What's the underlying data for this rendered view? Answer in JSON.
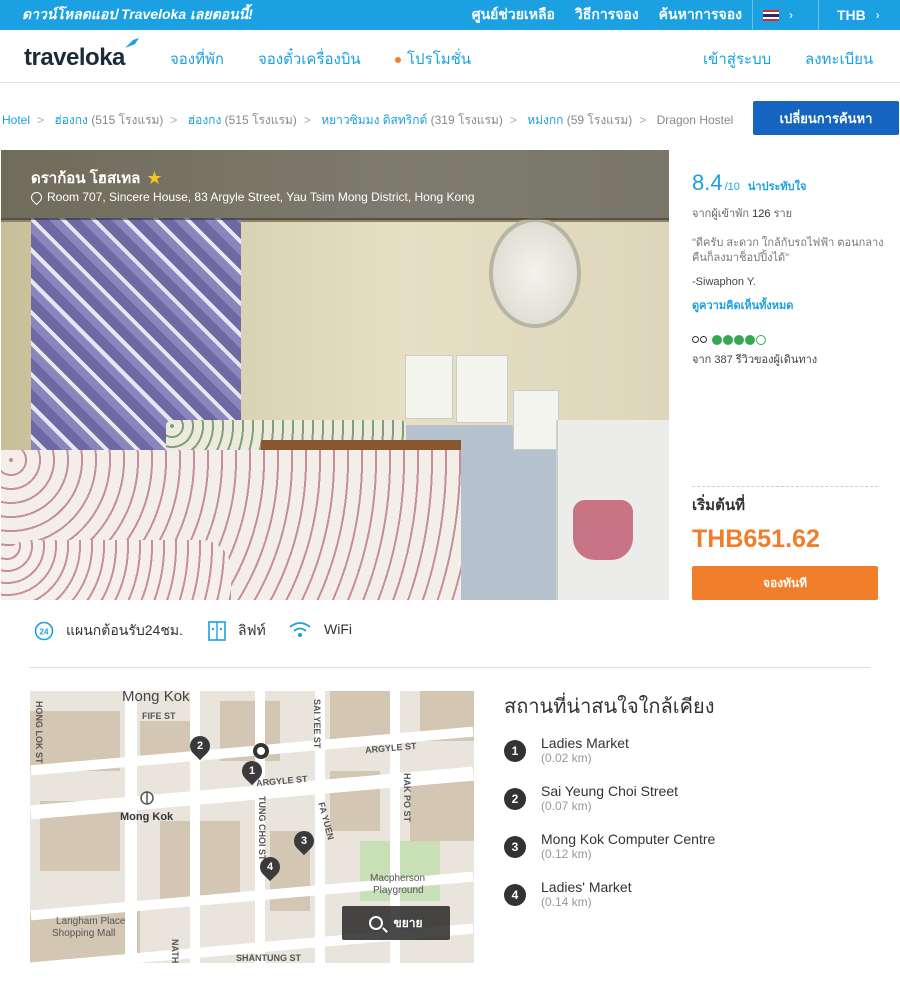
{
  "topbar": {
    "promo": "ดาวน์โหลดแอป Traveloka เลยตอนนี้!",
    "help": "ศูนย์ช่วยเหลือ",
    "howto": "วิธีการจอง",
    "find_booking": "ค้นหาการจอง",
    "currency": "THB"
  },
  "nav": {
    "logo": "traveloka",
    "hotels": "จองที่พัก",
    "flights": "จองตั๋วเครื่องบิน",
    "promos": "โปรโมชั่น",
    "login": "เข้าสู่ระบบ",
    "register": "ลงทะเบียน"
  },
  "breadcrumb": {
    "items": [
      {
        "label": "Hotel",
        "count": ""
      },
      {
        "label": "ฮ่องกง",
        "count": "(515 โรงแรม)"
      },
      {
        "label": "ฮ่องกง",
        "count": "(515 โรงแรม)"
      },
      {
        "label": "หยาวซิมมง ดิสทริกต์",
        "count": "(319 โรงแรม)"
      },
      {
        "label": "หม่งกก",
        "count": "(59 โรงแรม)"
      }
    ],
    "current": "Dragon Hostel",
    "change_search": "เปลี่ยนการค้นหา"
  },
  "hotel": {
    "name": "ดราก้อน โฮสเทล",
    "address": "Room 707, Sincere House, 83 Argyle Street, Yau Tsim Mong District, Hong Kong",
    "star_rating": 1
  },
  "review": {
    "score": "8.4",
    "out_of": "/10",
    "verdict": "น่าประทับใจ",
    "guest_prefix": "จากผู้เข้าพัก",
    "guest_count": "126",
    "guest_suffix": "ราย",
    "quote": "\"ดีครับ สะดวก ใกล้กับรถไฟฟ้า ตอนกลางคืนก็ลงมาช็อปปิ้งได้\"",
    "reviewer": "-Siwaphon Y.",
    "see_all": "ดูความคิดเห็นทั้งหมด",
    "tripadvisor_bubbles": 4,
    "tripadvisor_text": "จาก 387 รีวิวของผู้เดินทาง"
  },
  "pricing": {
    "from": "เริ่มต้นที่",
    "price": "THB651.62",
    "book": "จองทันที"
  },
  "amenities": [
    {
      "icon": "24h-icon",
      "label": "แผนกต้อนรับ24ชม."
    },
    {
      "icon": "elevator-icon",
      "label": "ลิฟท์"
    },
    {
      "icon": "wifi-icon",
      "label": "WiFi"
    }
  ],
  "map": {
    "zoom": "ขยาย",
    "labels": {
      "mongkok_top": "Mong Kok",
      "mongkok_station": "Mong Kok",
      "fife": "FIFE ST",
      "sai_yee": "SAI YEE ST",
      "argyle_right": "ARGYLE ST",
      "argyle_left": "ARGYLE ST",
      "hong_lok": "HONG LOK ST",
      "tung_choi": "TUNG CHOI ST",
      "fa_yuen": "FA YUEN",
      "hak_po": "HAK PO ST",
      "langham": "Langham Place",
      "shopping": "Shopping Mall",
      "macpherson": "Macpherson",
      "playground": "Playground",
      "nathan": "NATHAN RD",
      "shantung": "SHANTUNG ST"
    }
  },
  "nearby": {
    "title": "สถานที่น่าสนใจใกล้เคียง",
    "places": [
      {
        "num": "1",
        "name": "Ladies Market",
        "dist": "(0.02 km)"
      },
      {
        "num": "2",
        "name": "Sai Yeung Choi Street",
        "dist": "(0.07 km)"
      },
      {
        "num": "3",
        "name": "Mong Kok Computer Centre",
        "dist": "(0.12 km)"
      },
      {
        "num": "4",
        "name": "Ladies' Market",
        "dist": "(0.14 km)"
      }
    ]
  },
  "colors": {
    "accent": "#1ba0e2",
    "orange": "#f07e2a",
    "button_blue": "#1565c0"
  }
}
